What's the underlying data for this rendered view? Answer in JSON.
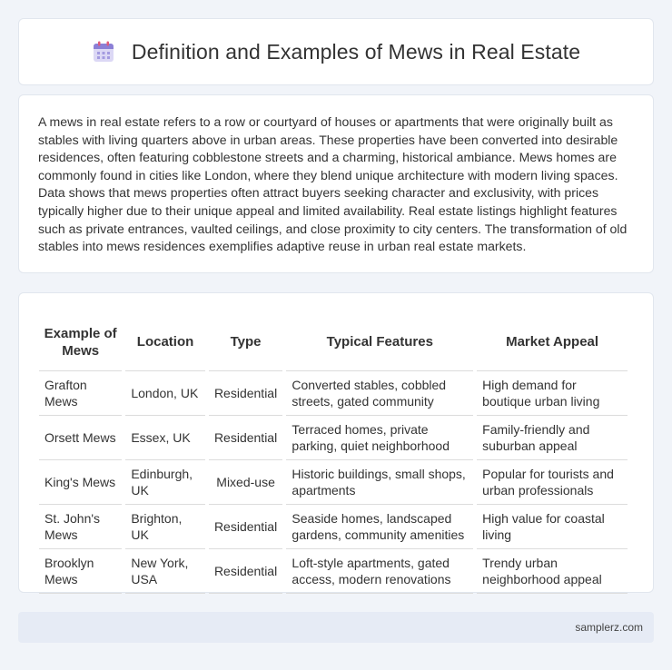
{
  "header": {
    "icon": "calendar-icon",
    "title": "Definition and Examples of Mews in Real Estate"
  },
  "description": "A mews in real estate refers to a row or courtyard of houses or apartments that were originally built as stables with living quarters above in urban areas. These properties have been converted into desirable residences, often featuring cobblestone streets and a charming, historical ambiance. Mews homes are commonly found in cities like London, where they blend unique architecture with modern living spaces. Data shows that mews properties often attract buyers seeking character and exclusivity, with prices typically higher due to their unique appeal and limited availability. Real estate listings highlight features such as private entrances, vaulted ceilings, and close proximity to city centers. The transformation of old stables into mews residences exemplifies adaptive reuse in urban real estate markets.",
  "table": {
    "headers": [
      "Example of Mews",
      "Location",
      "Type",
      "Typical Features",
      "Market Appeal"
    ],
    "rows": [
      [
        "Grafton Mews",
        "London, UK",
        "Residential",
        "Converted stables, cobbled streets, gated community",
        "High demand for boutique urban living"
      ],
      [
        "Orsett Mews",
        "Essex, UK",
        "Residential",
        "Terraced homes, private parking, quiet neighborhood",
        "Family-friendly and suburban appeal"
      ],
      [
        "King's Mews",
        "Edinburgh, UK",
        "Mixed-use",
        "Historic buildings, small shops, apartments",
        "Popular for tourists and urban professionals"
      ],
      [
        "St. John's Mews",
        "Brighton, UK",
        "Residential",
        "Seaside homes, landscaped gardens, community amenities",
        "High value for coastal living"
      ],
      [
        "Brooklyn Mews",
        "New York, USA",
        "Residential",
        "Loft-style apartments, gated access, modern renovations",
        "Trendy urban neighborhood appeal"
      ]
    ]
  },
  "footer": {
    "site": "samplerz.com"
  },
  "colors": {
    "background": "#f1f4f9",
    "card": "#ffffff",
    "footer": "#e6ebf5",
    "icon_accent": "#8b7fd6"
  }
}
